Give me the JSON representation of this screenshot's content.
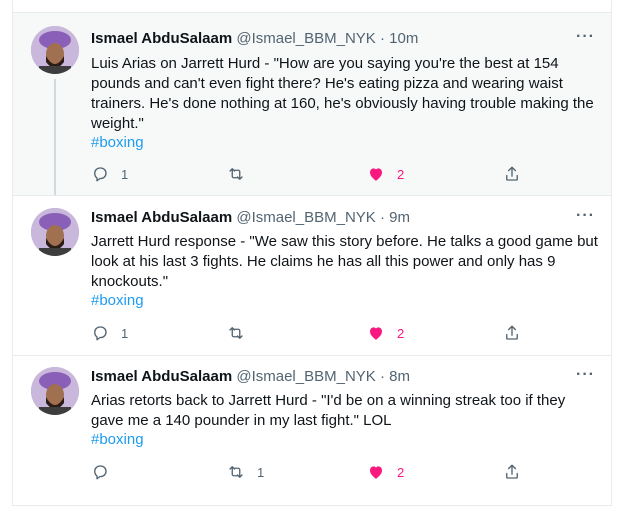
{
  "tweets": [
    {
      "name": "Ismael AbduSalaam",
      "handle": "@Ismael_BBM_NYK",
      "dot": "·",
      "time": "10m",
      "text": "Luis Arias on Jarrett Hurd - \"How are you saying you're the best at 154 pounds and can't even fight there? He's eating pizza and wearing waist trainers. He's done nothing at 160, he's obviously having trouble making the weight.\"",
      "hashtag": "#boxing",
      "reply_count": "1",
      "retweet_count": "",
      "like_count": "2"
    },
    {
      "name": "Ismael AbduSalaam",
      "handle": "@Ismael_BBM_NYK",
      "dot": "·",
      "time": "9m",
      "text": "Jarrett Hurd response - \"We saw this story before. He talks a good game but look at his last 3 fights. He claims he has all this power and only has 9 knockouts.\"",
      "hashtag": "#boxing",
      "reply_count": "1",
      "retweet_count": "",
      "like_count": "2"
    },
    {
      "name": "Ismael AbduSalaam",
      "handle": "@Ismael_BBM_NYK",
      "dot": "·",
      "time": "8m",
      "text": "Arias retorts back to Jarrett Hurd - \"I'd be on a winning streak too if they gave me a 140 pounder in my last fight.\" LOL",
      "hashtag": "#boxing",
      "reply_count": "",
      "retweet_count": "1",
      "like_count": "2"
    }
  ],
  "more_label": "···",
  "icons": {
    "reply": "reply-icon",
    "retweet": "retweet-icon",
    "like": "heart-icon",
    "share": "share-icon",
    "more": "more-icon"
  },
  "colors": {
    "like_active": "#f91880",
    "hashtag": "#1d9bf0",
    "muted": "#536471"
  }
}
